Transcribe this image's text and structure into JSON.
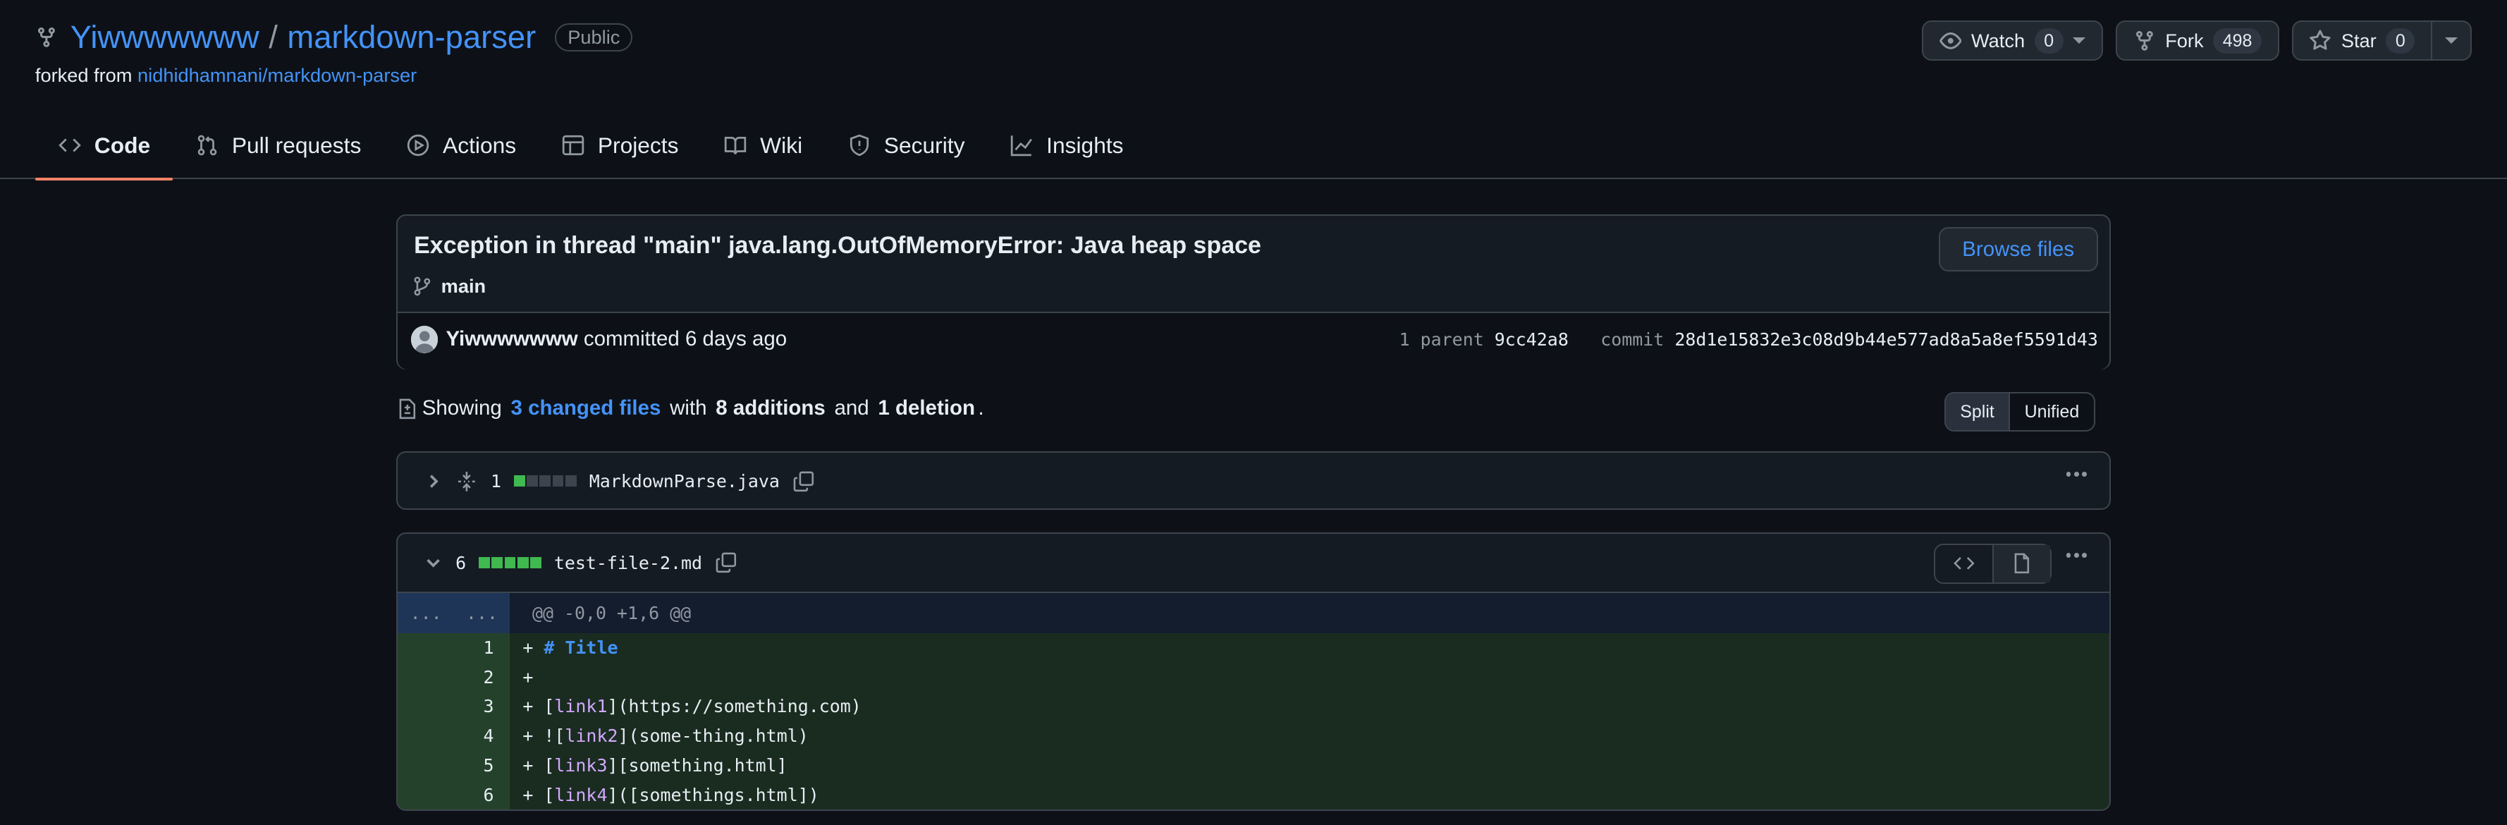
{
  "repo": {
    "owner": "Yiwwwwwww",
    "separator": "/",
    "name": "markdown-parser",
    "visibility": "Public",
    "forked_label": "forked from ",
    "forked_from": "nidhidhamnani/markdown-parser"
  },
  "actions": {
    "watch_label": "Watch",
    "watch_count": "0",
    "fork_label": "Fork",
    "fork_count": "498",
    "star_label": "Star",
    "star_count": "0"
  },
  "tabs": [
    {
      "label": "Code",
      "icon": "code-icon"
    },
    {
      "label": "Pull requests",
      "icon": "pull-request-icon"
    },
    {
      "label": "Actions",
      "icon": "play-icon"
    },
    {
      "label": "Projects",
      "icon": "table-icon"
    },
    {
      "label": "Wiki",
      "icon": "book-icon"
    },
    {
      "label": "Security",
      "icon": "shield-icon"
    },
    {
      "label": "Insights",
      "icon": "graph-icon"
    }
  ],
  "commit": {
    "title": "Exception in thread \"main\" java.lang.OutOfMemoryError: Java heap space",
    "branch": "main",
    "browse_label": "Browse files",
    "author": "Yiwwwwwww",
    "committed_text": " committed 6 days ago",
    "parent_label": "1 parent",
    "parent_sha": "9cc42a8",
    "commit_label": "commit",
    "commit_sha": "28d1e15832e3c08d9b44e577ad8a5a8ef5591d43"
  },
  "summary": {
    "showing": "Showing ",
    "changed_files": "3 changed files",
    "with": " with ",
    "additions": "8 additions",
    "and": " and ",
    "deletions": "1 deletion",
    "period": ".",
    "split_label": "Split",
    "unified_label": "Unified"
  },
  "files": [
    {
      "count": "1",
      "name": "MarkdownParse.java"
    },
    {
      "count": "6",
      "name": "test-file-2.md"
    }
  ],
  "diff": {
    "gutter_left": "...",
    "gutter_right": "...",
    "hunk_header": "@@ -0,0 +1,6 @@",
    "lines": [
      {
        "num": "1",
        "prefix": "+ ",
        "parts": [
          [
            "t",
            "# Title"
          ]
        ]
      },
      {
        "num": "2",
        "prefix": "+ ",
        "parts": []
      },
      {
        "num": "3",
        "prefix": "+ ",
        "parts": [
          [
            "p",
            "["
          ],
          [
            "l",
            "link1"
          ],
          [
            "p",
            "](https://something.com)"
          ]
        ]
      },
      {
        "num": "4",
        "prefix": "+ ",
        "parts": [
          [
            "p",
            "!["
          ],
          [
            "l",
            "link2"
          ],
          [
            "p",
            "](some-thing.html)"
          ]
        ]
      },
      {
        "num": "5",
        "prefix": "+ ",
        "parts": [
          [
            "p",
            "["
          ],
          [
            "l",
            "link3"
          ],
          [
            "p",
            "][something.html]"
          ]
        ]
      },
      {
        "num": "6",
        "prefix": "+ ",
        "parts": [
          [
            "p",
            "["
          ],
          [
            "l",
            "link4"
          ],
          [
            "p",
            "]([somethings.html])"
          ]
        ]
      }
    ]
  },
  "colors": {
    "accent": "#4493f8",
    "tab_underline": "#f78166",
    "addition_green": "#3fb950"
  }
}
